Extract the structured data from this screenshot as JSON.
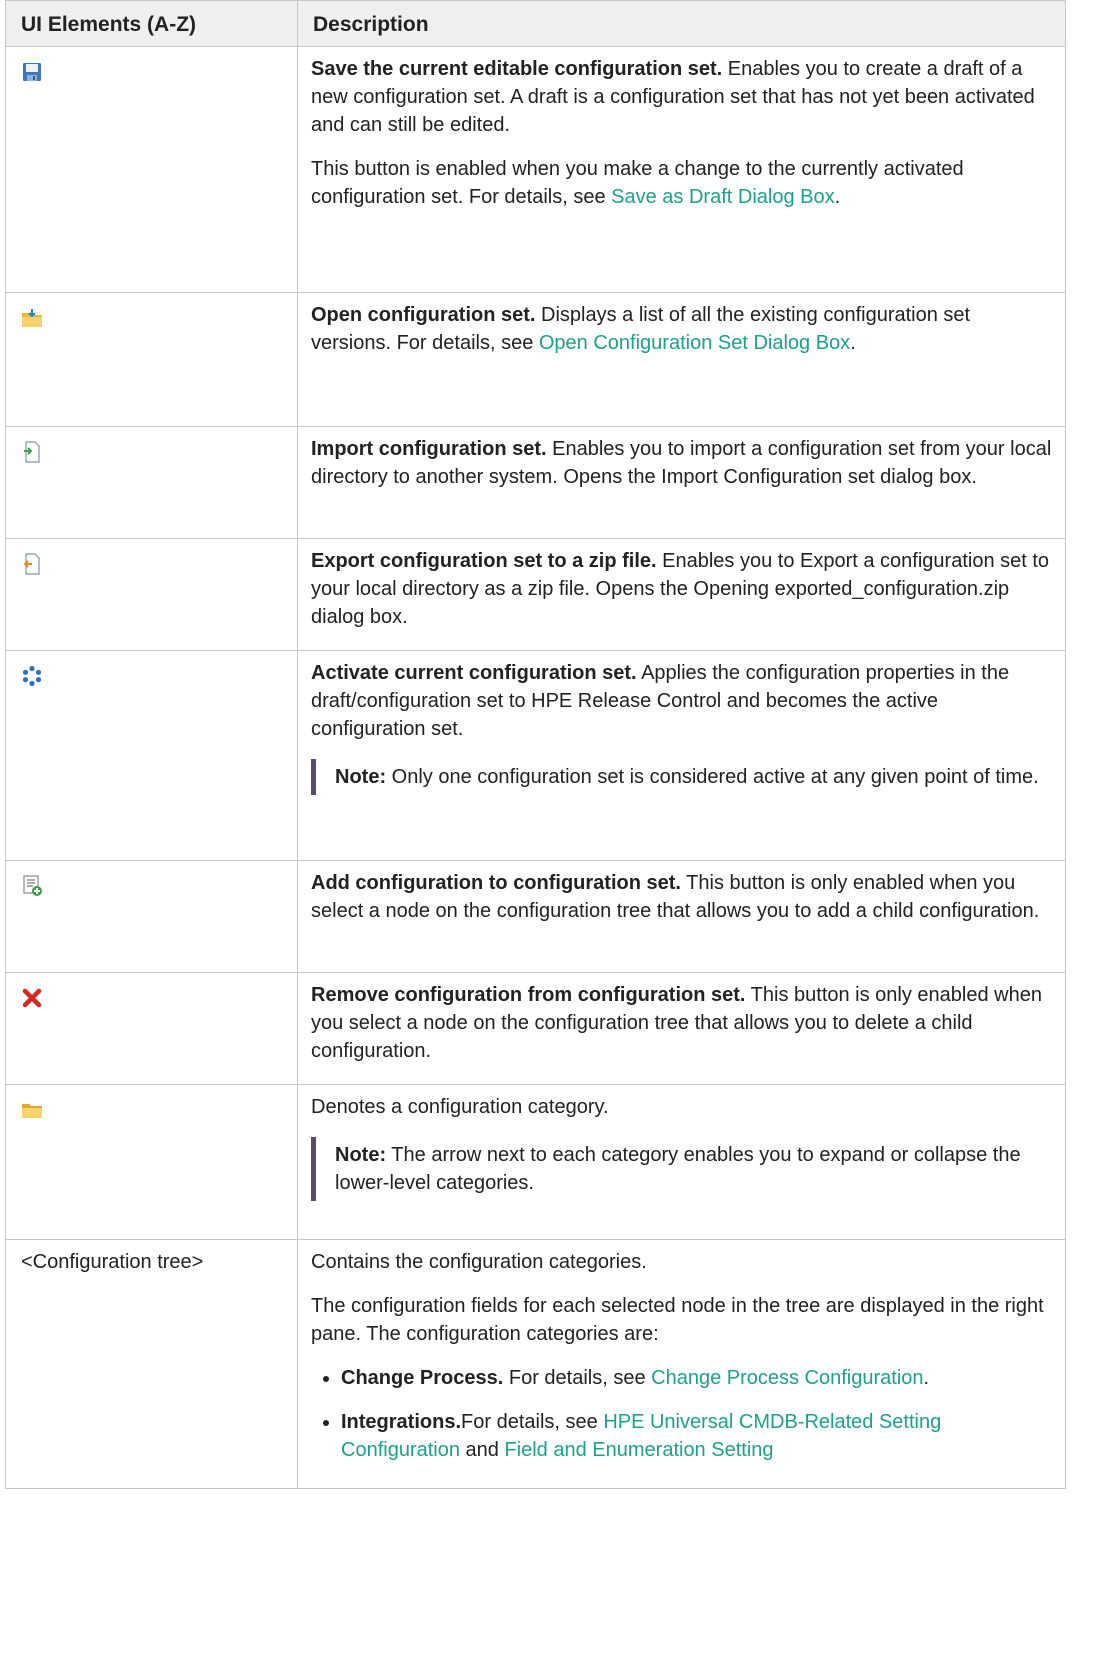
{
  "headers": {
    "col1": "UI Elements (A-Z)",
    "col2": "Description"
  },
  "rows": {
    "save": {
      "icon": "save-disk-icon",
      "title": "Save the current editable configuration set.",
      "text1": " Enables you to create a draft of a new configuration set. A draft is a configuration set that has not yet been activated and can still be edited.",
      "text2": "This button is enabled when you make a change to the currently activated configuration set. For details, see ",
      "link": "Save as Draft Dialog Box",
      "after": "."
    },
    "open": {
      "icon": "open-folder-icon",
      "title": "Open configuration set.",
      "text1": " Displays a list of all the existing configuration set versions. For details, see ",
      "link": "Open Configuration Set Dialog Box",
      "after": "."
    },
    "import": {
      "icon": "import-document-icon",
      "title": "Import configuration set.",
      "text1": " Enables you to import a configuration set from your local directory to another system. Opens the Import Configuration set dialog box."
    },
    "export": {
      "icon": "export-document-icon",
      "title": "Export configuration set to a zip file.",
      "text1": " Enables you to Export a configuration set to your local directory as a zip file. Opens the Opening exported_configuration.zip dialog box."
    },
    "activate": {
      "icon": "activate-gear-icon",
      "title": "Activate current configuration set.",
      "text1": " Applies the configuration properties in the draft/configuration set to HPE Release Control and becomes the active configuration set.",
      "note_label": "Note:",
      "note_text": " Only one configuration set is considered active at any given point of time."
    },
    "add": {
      "icon": "add-configuration-icon",
      "title": "Add configuration to configuration set.",
      "text1": " This button is only enabled when you select a node on the configuration tree that allows you to add a child configuration."
    },
    "remove": {
      "icon": "remove-x-icon",
      "title": "Remove configuration from configuration set.",
      "text1": " This button is only enabled when you select a node on the configuration tree that allows you to delete a child configuration."
    },
    "category": {
      "icon": "category-folder-icon",
      "text1": "Denotes a configuration category.",
      "note_label": "Note:",
      "note_text": " The arrow next to each category enables you to expand or collapse the lower-level categories."
    },
    "tree": {
      "label": "<Configuration tree>",
      "text1": "Contains the configuration categories.",
      "text2": "The configuration fields for each selected node in the tree are displayed in the right pane. The configuration categories are:",
      "items": [
        {
          "title": "Change Process.",
          "pre": " For details, see ",
          "link": "Change Process Configuration",
          "after": "."
        },
        {
          "title": "Integrations.",
          "pre": "For details, see ",
          "link": "HPE Universal CMDB-Related Setting Configuration",
          "mid": " and ",
          "link2": "Field and Enumeration Setting"
        }
      ]
    }
  },
  "colors": {
    "link": "#1aa38a",
    "note_bar": "#5b4a6e",
    "header_bg": "#efefef",
    "border": "#c8c8c8"
  }
}
